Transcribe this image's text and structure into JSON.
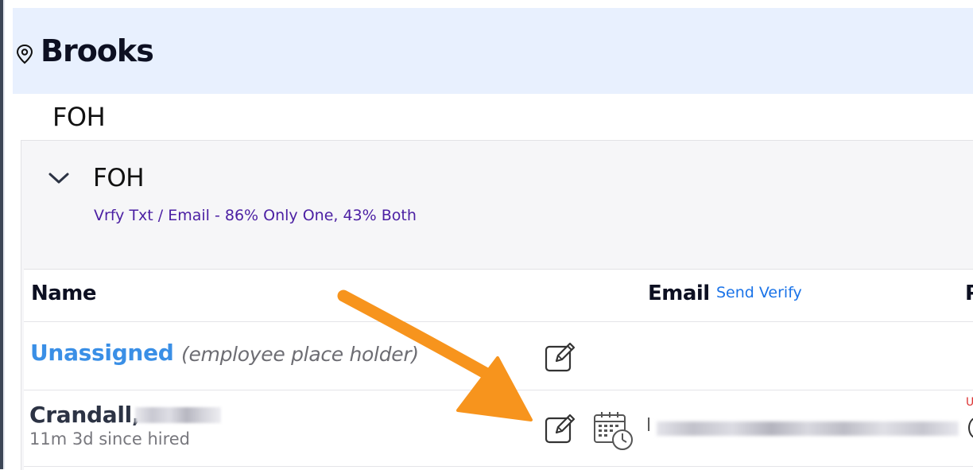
{
  "location": {
    "name": "Brooks",
    "icon": "map-pin-icon"
  },
  "department": {
    "title": "FOH"
  },
  "section": {
    "title": "FOH",
    "verify_stats": "Vrfy Txt / Email - 86% Only One, 43% Both",
    "expanded": true
  },
  "table": {
    "headers": {
      "name": "Name",
      "email": "Email",
      "send_verify": "Send Verify",
      "next_col_cut": "P"
    },
    "rows": [
      {
        "name": "Unassigned",
        "note": "(employee place holder)",
        "actions": [
          "edit-icon"
        ]
      },
      {
        "name": "Crandall,",
        "tenure": "11m 3d since hired",
        "email_prefix": "l",
        "status_cut": "U",
        "actions": [
          "edit-icon",
          "schedule-icon"
        ]
      }
    ]
  },
  "colors": {
    "location_bar_bg": "#e8f0fe",
    "link_blue": "#3a8fe6",
    "stats_purple": "#4b1fa3",
    "annotation_arrow": "#f7941d"
  }
}
